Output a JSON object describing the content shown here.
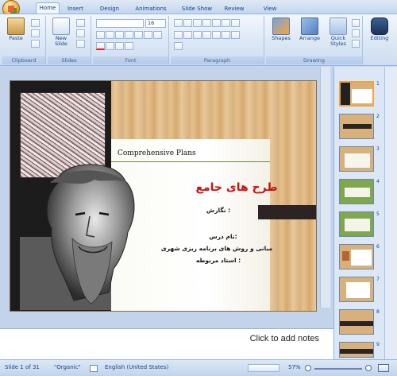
{
  "ribbon": {
    "tabs": [
      "Home",
      "Insert",
      "Design",
      "Animations",
      "Slide Show",
      "Review",
      "View"
    ],
    "active_tab": "Home",
    "groups": {
      "clipboard": "Clipboard",
      "slides": "Slides",
      "font": "Font",
      "paragraph": "Paragraph",
      "drawing": "Drawing"
    },
    "paste_label": "Paste",
    "new_slide_label": "New Slide",
    "shapes_label": "Shapes",
    "arrange_label": "Arrange",
    "quick_styles_label": "Quick Styles",
    "editing_label": "Editing",
    "font_size": "16"
  },
  "slide": {
    "english_title": "Comprehensive  Plans",
    "title": "طرح های جامع",
    "line1": "نگارش :",
    "line2": "نام درس:",
    "line3": "مبانی و روش های برنامه ریزی شهری",
    "line4": "استاد مربوطه :"
  },
  "thumbnails": [
    "1",
    "2",
    "3",
    "4",
    "5",
    "6",
    "7",
    "8",
    "9"
  ],
  "notes": {
    "placeholder": "Click to add notes"
  },
  "status": {
    "slide_counter": "Slide 1 of 31",
    "theme": "\"Organic\"",
    "language": "English (United States)",
    "zoom": "57%"
  },
  "colors": {
    "ribbon": "#dae6f4",
    "title_red": "#cc1010",
    "wood": "#d8b07a"
  }
}
